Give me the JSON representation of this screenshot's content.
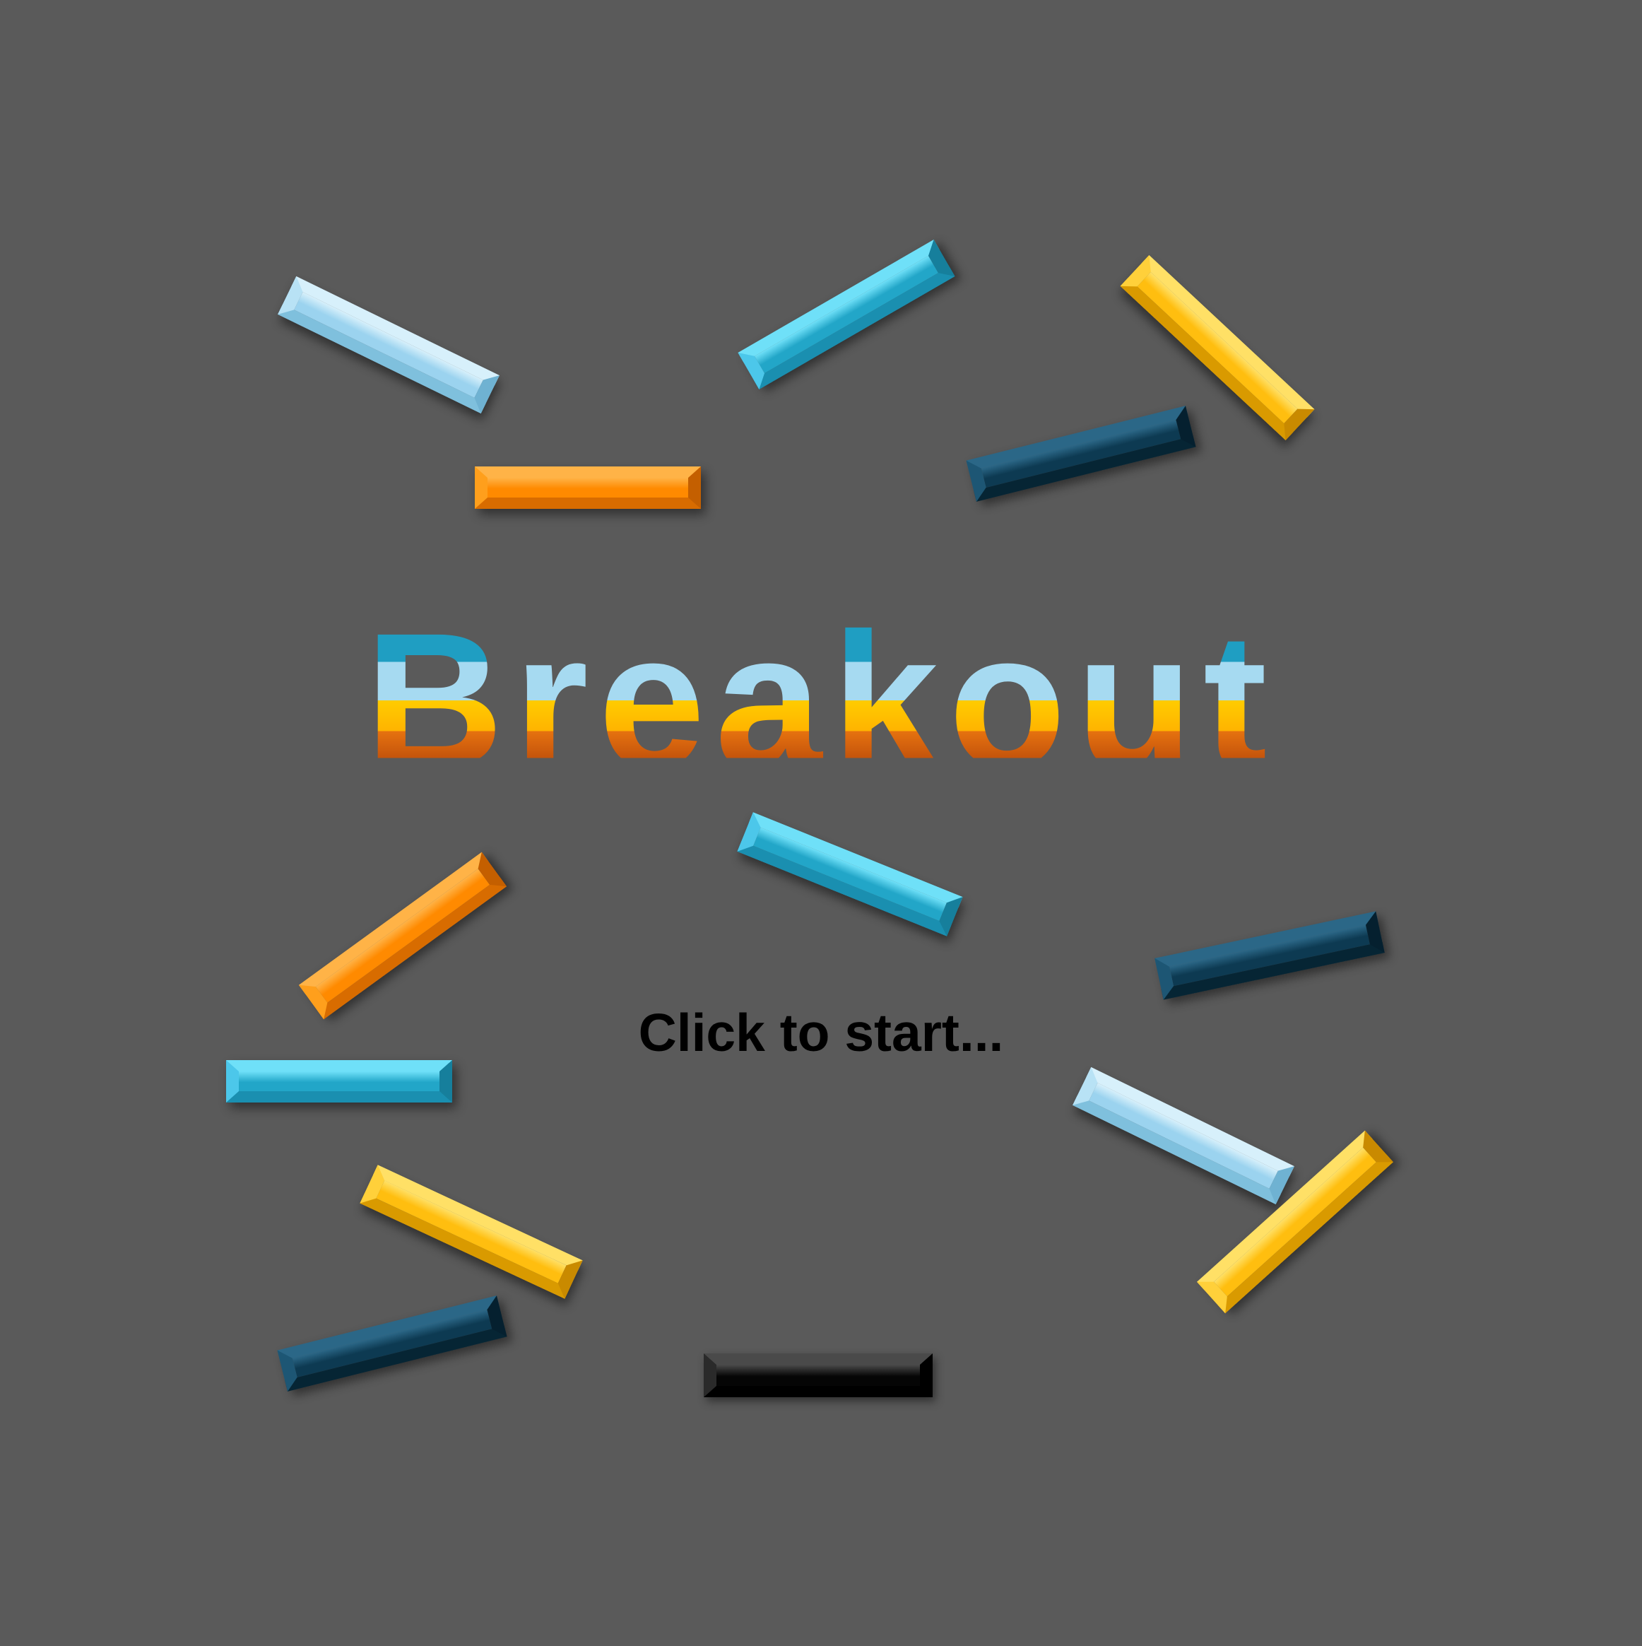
{
  "game": {
    "title": "Breakout",
    "prompt": "Click to start...",
    "background_color": "#5a5a5a"
  },
  "palette": {
    "lightblue": {
      "top": "#d7f0fb",
      "left": "#b8e2f5",
      "right": "#6fb2d2",
      "bottom": "#7fc0dd",
      "face": "#9bd3ef"
    },
    "cyan": {
      "top": "#6fe0f8",
      "left": "#4cc7ea",
      "right": "#167f9c",
      "bottom": "#1a8fb0",
      "face": "#22a6c8"
    },
    "yellow": {
      "top": "#ffe066",
      "left": "#ffd03a",
      "right": "#c98a00",
      "bottom": "#d99a00",
      "face": "#ffbe0f"
    },
    "orange": {
      "top": "#ffb347",
      "left": "#ff9f1c",
      "right": "#c45f00",
      "bottom": "#d86c00",
      "face": "#ff8a00"
    },
    "navy": {
      "top": "#2b6787",
      "left": "#1d5674",
      "right": "#05202f",
      "bottom": "#062534",
      "face": "#0d3a52"
    },
    "black": {
      "top": "#4a4a4a",
      "left": "#2a2a2a",
      "right": "#000000",
      "bottom": "#000000",
      "face": "#050505"
    }
  },
  "bricks": [
    {
      "color": "lightblue",
      "angle_deg": 26
    },
    {
      "color": "cyan",
      "angle_deg": -30
    },
    {
      "color": "yellow",
      "angle_deg": 43
    },
    {
      "color": "orange",
      "angle_deg": 0
    },
    {
      "color": "navy",
      "angle_deg": -14
    },
    {
      "color": "orange",
      "angle_deg": -36
    },
    {
      "color": "cyan",
      "angle_deg": 22
    },
    {
      "color": "navy",
      "angle_deg": -12
    },
    {
      "color": "cyan",
      "angle_deg": 0
    },
    {
      "color": "lightblue",
      "angle_deg": 26
    },
    {
      "color": "yellow",
      "angle_deg": -42
    },
    {
      "color": "yellow",
      "angle_deg": 25
    },
    {
      "color": "navy",
      "angle_deg": -14
    }
  ],
  "paddle": {
    "color": "black"
  }
}
